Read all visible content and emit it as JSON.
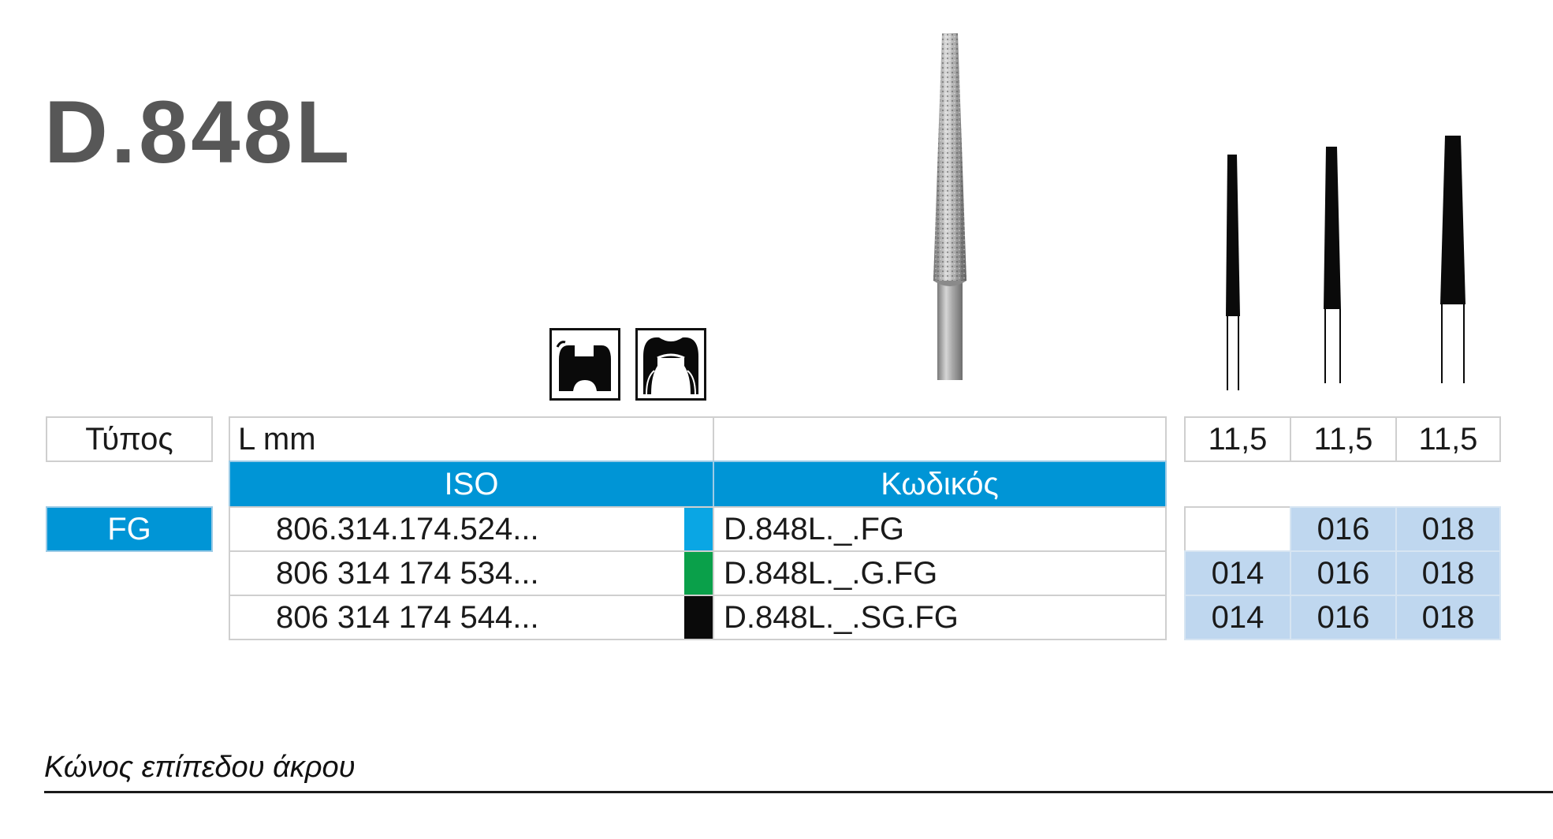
{
  "title": "D.848L",
  "table": {
    "type_label": "Τύπος",
    "lmm_label": "L mm",
    "iso_label": "ISO",
    "code_label": "Κωδικός",
    "fg_label": "FG",
    "lengths": [
      "11,5",
      "11,5",
      "11,5"
    ],
    "rows": [
      {
        "iso": "806.314.174.524...",
        "code": "D.848L._.FG",
        "grit_color": "#0aa6e4",
        "sizes": [
          "",
          "016",
          "018"
        ]
      },
      {
        "iso": "806 314 174 534...",
        "code": "D.848L._.G.FG",
        "grit_color": "#0aa04a",
        "sizes": [
          "014",
          "016",
          "018"
        ]
      },
      {
        "iso": "806 314 174 544...",
        "code": "D.848L._.SG.FG",
        "grit_color": "#0a0a0a",
        "sizes": [
          "014",
          "016",
          "018"
        ]
      }
    ]
  },
  "caption": "Κώνος επίπεδου άκρου",
  "icons": [
    "cavity-preparation-icon",
    "crown-preparation-icon"
  ],
  "colors": {
    "accent": "#0095d6",
    "size_cell": "#bfd7ef",
    "title": "#575757"
  }
}
